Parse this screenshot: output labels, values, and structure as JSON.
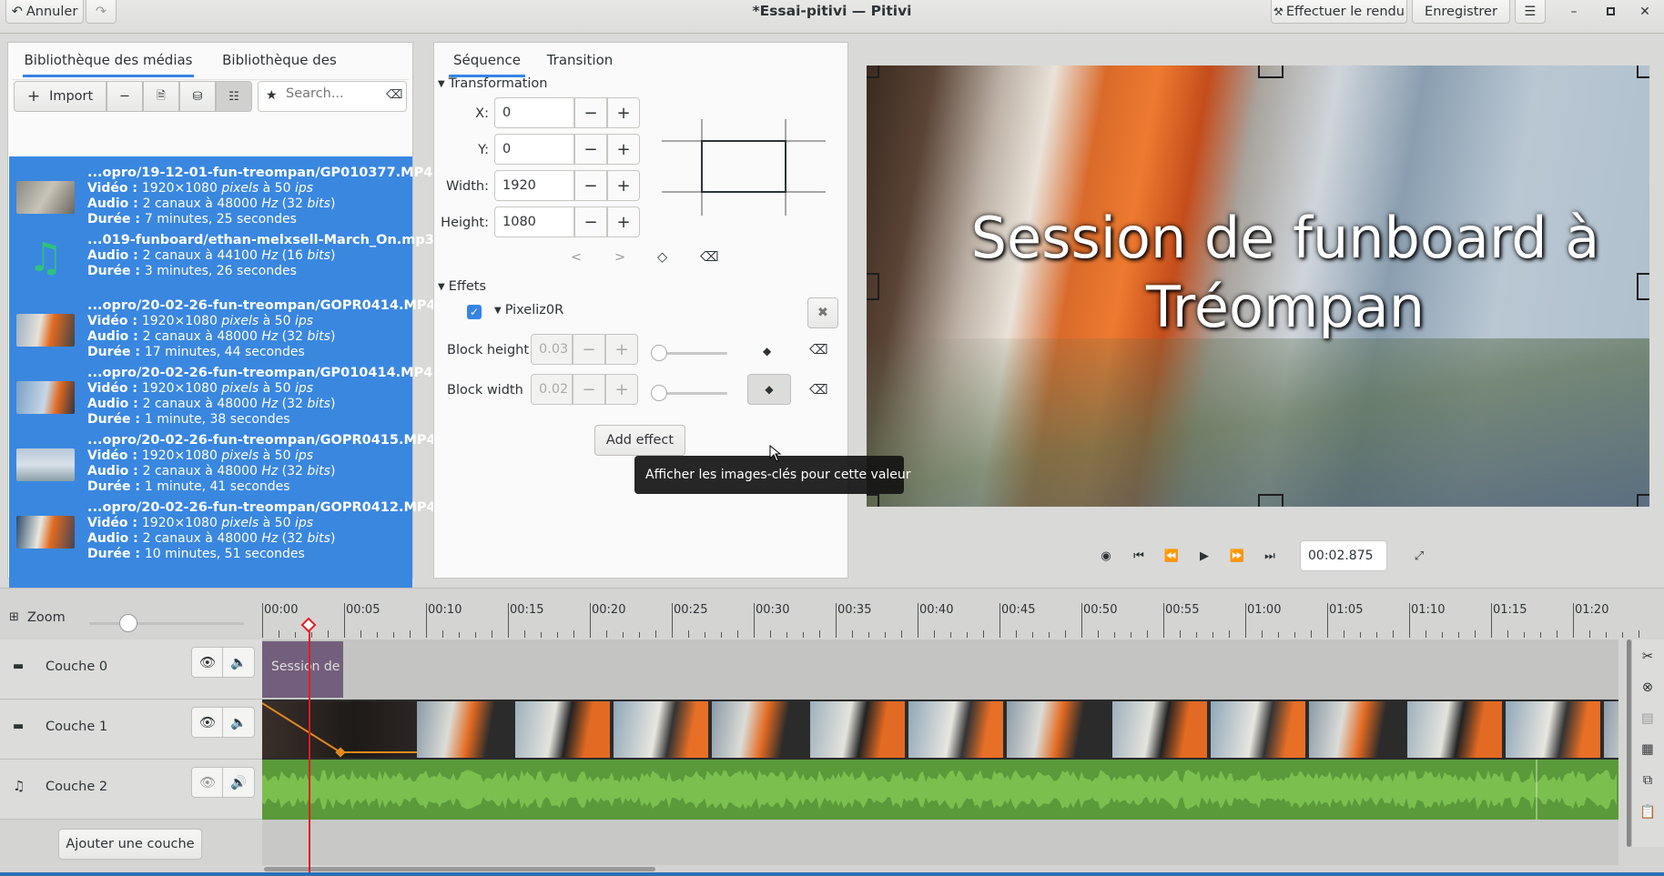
{
  "window": {
    "title": "*Essai-pitivi — Pitivi"
  },
  "header": {
    "undo_label": "Annuler",
    "render_label": "Effectuer le rendu",
    "save_label": "Enregistrer"
  },
  "media_panel": {
    "tabs": [
      "Bibliothèque des médias",
      "Bibliothèque des effets"
    ],
    "import_label": "Import",
    "search_placeholder": "Search...",
    "items": [
      {
        "name": "...opro/19-12-01-fun-treompan/GP010377.MP4",
        "lines": [
          [
            "Vidéo : ",
            "1920×1080 ",
            "pixels",
            " à 50 ",
            "ips"
          ],
          [
            "Audio : ",
            "2 canaux à 48000 ",
            "Hz",
            " (32 ",
            "bits",
            ")"
          ],
          [
            "Durée : ",
            "7 minutes, 25 secondes"
          ]
        ]
      },
      {
        "name": "...019-funboard/ethan-melxsell-March_On.mp3",
        "lines": [
          [
            "Audio : ",
            "2 canaux à 44100 ",
            "Hz",
            " (16 ",
            "bits",
            ")"
          ],
          [
            "Durée : ",
            "3 minutes, 26 secondes"
          ]
        ]
      },
      {
        "name": "...opro/20-02-26-fun-treompan/GOPR0414.MP4",
        "lines": [
          [
            "Vidéo : ",
            "1920×1080 ",
            "pixels",
            " à 50 ",
            "ips"
          ],
          [
            "Audio : ",
            "2 canaux à 48000 ",
            "Hz",
            " (32 ",
            "bits",
            ")"
          ],
          [
            "Durée : ",
            "17 minutes, 44 secondes"
          ]
        ]
      },
      {
        "name": "...opro/20-02-26-fun-treompan/GP010414.MP4",
        "lines": [
          [
            "Vidéo : ",
            "1920×1080 ",
            "pixels",
            " à 50 ",
            "ips"
          ],
          [
            "Audio : ",
            "2 canaux à 48000 ",
            "Hz",
            " (32 ",
            "bits",
            ")"
          ],
          [
            "Durée : ",
            "1 minute, 38 secondes"
          ]
        ]
      },
      {
        "name": "...opro/20-02-26-fun-treompan/GOPR0415.MP4",
        "lines": [
          [
            "Vidéo : ",
            "1920×1080 ",
            "pixels",
            " à 50 ",
            "ips"
          ],
          [
            "Audio : ",
            "2 canaux à 48000 ",
            "Hz",
            " (32 ",
            "bits",
            ")"
          ],
          [
            "Durée : ",
            "1 minute, 41 secondes"
          ]
        ]
      },
      {
        "name": "...opro/20-02-26-fun-treompan/GOPR0412.MP4",
        "lines": [
          [
            "Vidéo : ",
            "1920×1080 ",
            "pixels",
            " à 50 ",
            "ips"
          ],
          [
            "Audio : ",
            "2 canaux à 48000 ",
            "Hz",
            " (32 ",
            "bits",
            ")"
          ],
          [
            "Durée : ",
            "10 minutes, 51 secondes"
          ]
        ]
      }
    ]
  },
  "clip_panel": {
    "tabs": [
      "Séquence",
      "Transition"
    ],
    "transformation_label": "Transformation",
    "x_label": "X:",
    "x_value": "0",
    "y_label": "Y:",
    "y_value": "0",
    "width_label": "Width:",
    "width_value": "1920",
    "height_label": "Height:",
    "height_value": "1080",
    "effects_label": "Effets",
    "effect_name": "Pixeliz0R",
    "block_height_label": "Block height",
    "block_height_value": "0.03",
    "block_width_label": "Block width",
    "block_width_value": "0.02",
    "add_effect_label": "Add effect",
    "tooltip": "Afficher les images-clés pour cette valeur"
  },
  "viewer": {
    "title_overlay_line1": "Session de funboard à",
    "title_overlay_line2": "Tréompan",
    "timecode": "00:02.875"
  },
  "timeline": {
    "zoom_label": "Zoom",
    "ruler": [
      "00:00",
      "00:05",
      "00:10",
      "00:15",
      "00:20",
      "00:25",
      "00:30",
      "00:35",
      "00:40",
      "00:45",
      "00:50",
      "00:55",
      "01:00",
      "01:05",
      "01:10",
      "01:15",
      "01:20"
    ],
    "layers": [
      {
        "name": "Couche 0"
      },
      {
        "name": "Couche 1"
      },
      {
        "name": "Couche 2"
      }
    ],
    "title_clip_label": "Session de",
    "add_layer_label": "Ajouter une couche"
  }
}
